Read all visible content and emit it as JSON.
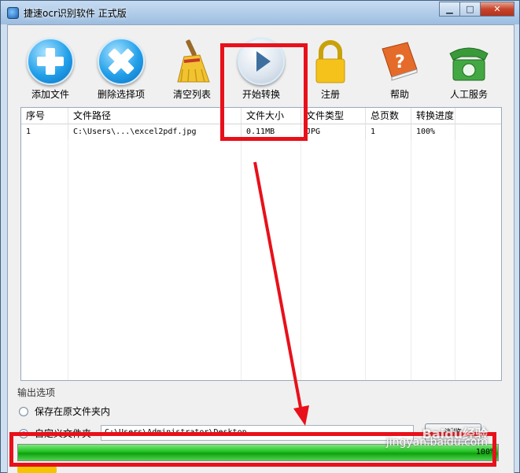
{
  "window": {
    "title": "捷速ocr识别软件 正式版",
    "controls": {
      "minimize": "▁",
      "maximize": "□",
      "close": "✕"
    }
  },
  "toolbar": {
    "items": [
      {
        "label": "添加文件",
        "icon": "add-icon"
      },
      {
        "label": "删除选择项",
        "icon": "delete-icon"
      },
      {
        "label": "清空列表",
        "icon": "broom-icon"
      },
      {
        "label": "开始转换",
        "icon": "play-icon"
      },
      {
        "label": "注册",
        "icon": "lock-icon"
      },
      {
        "label": "帮助",
        "icon": "help-book-icon"
      },
      {
        "label": "人工服务",
        "icon": "phone-icon"
      }
    ]
  },
  "grid": {
    "columns": [
      "序号",
      "文件路径",
      "文件大小",
      "文件类型",
      "总页数",
      "转换进度"
    ],
    "rows": [
      [
        "1",
        "C:\\Users\\...\\excel2pdf.jpg",
        "0.11MB",
        "JPG",
        "1",
        "100%"
      ]
    ]
  },
  "output": {
    "title": "输出选项",
    "option_original": "保存在原文件夹内",
    "option_custom": "自定义文件夹",
    "custom_selected": true,
    "path": "C:\\Users\\Administrator\\Desktop",
    "browse_label": "浏览"
  },
  "progress": {
    "value": 1.0,
    "text": "100%"
  },
  "watermark": {
    "line1": "Baidu经验",
    "line2": "jingyan.baidu.com"
  },
  "colors": {
    "annotation_red": "#e8101a",
    "progress_green": "#20c020"
  }
}
